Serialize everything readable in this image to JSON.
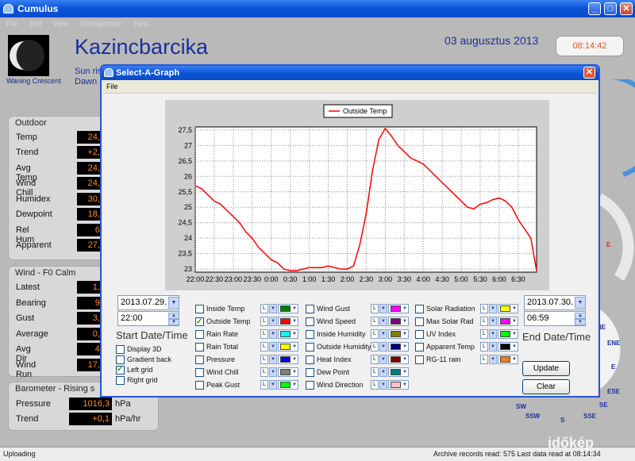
{
  "app": {
    "title": "Cumulus",
    "menu": [
      "File",
      "Edit",
      "View",
      "Configuration",
      "Help"
    ],
    "window_buttons": [
      "_",
      "□",
      "✕"
    ],
    "moon_phase": "Waning Crescent",
    "station": "Kazincbarcika",
    "date": "03 augusztus 2013",
    "time": "08:14:42",
    "sun_partial": "Sun ris",
    "dawn_partial": "Dawn"
  },
  "outdoor": {
    "title": "Outdoor",
    "rows": [
      {
        "label": "Temp",
        "value": "24,3"
      },
      {
        "label": "Trend",
        "value": "+2,6"
      },
      {
        "label": "Avg Temp",
        "value": "24,6"
      },
      {
        "label": "Wind Chill",
        "value": "24,3"
      },
      {
        "label": "Humidex",
        "value": "30,4"
      },
      {
        "label": "Dewpoint",
        "value": "18,3"
      },
      {
        "label": "Rel Hum",
        "value": "69"
      },
      {
        "label": "Apparent",
        "value": "27,0"
      }
    ]
  },
  "wind": {
    "title": "Wind - F0 Calm",
    "rows": [
      {
        "label": "Latest",
        "value": "1,1"
      },
      {
        "label": "Bearing",
        "value": "90"
      },
      {
        "label": "Gust",
        "value": "3,6"
      },
      {
        "label": "Average",
        "value": "0,9"
      },
      {
        "label": "Avg Dir",
        "value": "46"
      },
      {
        "label": "Wind Run",
        "value": "17,4"
      }
    ]
  },
  "barometer": {
    "title": "Barometer - Rising s",
    "rows": [
      {
        "label": "Pressure",
        "value": "1016,3",
        "unit": "hPa"
      },
      {
        "label": "Trend",
        "value": "+0,1",
        "unit": "hPa/hr"
      }
    ]
  },
  "compass": {
    "labels": [
      "NE",
      "ENE",
      "E",
      "ESE",
      "SE",
      "SSE",
      "S",
      "SSW",
      "SW"
    ],
    "e_marker": "E"
  },
  "status": {
    "left": "Uploading",
    "right": "Archive records read: 575  Last data read at 08:14:34",
    "watermark": "időkép"
  },
  "dialog": {
    "title": "Select-A-Graph",
    "close": "✕",
    "menu": "File",
    "start_date": "2013.07.29.",
    "start_time": "22:00",
    "start_label": "Start Date/Time",
    "end_date": "2013.07.30.",
    "end_time": "06:59",
    "end_label": "End Date/Time",
    "options": [
      {
        "label": "Display 3D",
        "checked": false
      },
      {
        "label": "Gradient back",
        "checked": false
      },
      {
        "label": "Left grid",
        "checked": true
      },
      {
        "label": "Right grid",
        "checked": false
      }
    ],
    "col1": [
      {
        "label": "Inside Temp",
        "checked": false,
        "color": "#008000"
      },
      {
        "label": "Outside Temp",
        "checked": true,
        "color": "#ff0000"
      },
      {
        "label": "Rain Rate",
        "checked": false,
        "color": "#00ffff"
      },
      {
        "label": "Rain Total",
        "checked": false,
        "color": "#ffff00"
      },
      {
        "label": "Pressure",
        "checked": false,
        "color": "#0000ff"
      },
      {
        "label": "Wind Chill",
        "checked": false,
        "color": "#808080"
      },
      {
        "label": "Peak Gust",
        "checked": false,
        "color": "#00ff00"
      }
    ],
    "col2": [
      {
        "label": "Wind Gust",
        "checked": false,
        "color": "#ff00ff"
      },
      {
        "label": "Wind Speed",
        "checked": false,
        "color": "#800080"
      },
      {
        "label": "Inside Humidity",
        "checked": false,
        "color": "#808000"
      },
      {
        "label": "Outside Humidity",
        "checked": false,
        "color": "#000080"
      },
      {
        "label": "Heat Index",
        "checked": false,
        "color": "#800000"
      },
      {
        "label": "Dew Point",
        "checked": false,
        "color": "#008080"
      },
      {
        "label": "Wind Direction",
        "checked": false,
        "color": "#ffc0cb"
      }
    ],
    "col3": [
      {
        "label": "Solar Radiation",
        "checked": false,
        "color": "#ffff00"
      },
      {
        "label": "Max Solar Rad",
        "checked": false,
        "color": "#ff00ff"
      },
      {
        "label": "UV Index",
        "checked": false,
        "color": "#00ff00"
      },
      {
        "label": "Apparent Temp",
        "checked": false,
        "color": "#000000"
      },
      {
        "label": "RG-11 rain",
        "checked": false,
        "color": "#ff8000"
      }
    ],
    "axis_letter": "L",
    "update_label": "Update",
    "clear_label": "Clear"
  },
  "chart_data": {
    "type": "line",
    "legend": [
      "Outside Temp"
    ],
    "legend_position": "top-center",
    "grid": true,
    "ylim": [
      22.9,
      27.6
    ],
    "yticks": [
      "27,5",
      "27",
      "26,5",
      "26",
      "25,5",
      "25",
      "24,5",
      "24",
      "23,5",
      "23"
    ],
    "xticks": [
      "22:00",
      "22:30",
      "23:00",
      "23:30",
      "0:00",
      "0:30",
      "1:00",
      "1:30",
      "2:00",
      "2:30",
      "3:00",
      "3:30",
      "4:00",
      "4:30",
      "5:00",
      "5:30",
      "6:00",
      "6:30"
    ],
    "series": [
      {
        "name": "Outside Temp",
        "color": "#ff0000",
        "x": [
          "22:00",
          "22:10",
          "22:20",
          "22:30",
          "22:40",
          "22:50",
          "23:00",
          "23:10",
          "23:20",
          "23:30",
          "23:40",
          "23:50",
          "0:00",
          "0:10",
          "0:20",
          "0:30",
          "0:40",
          "0:50",
          "1:00",
          "1:10",
          "1:20",
          "1:30",
          "1:40",
          "1:50",
          "2:00",
          "2:10",
          "2:20",
          "2:30",
          "2:40",
          "2:50",
          "3:00",
          "3:10",
          "3:20",
          "3:30",
          "3:40",
          "3:50",
          "4:00",
          "4:10",
          "4:20",
          "4:30",
          "4:40",
          "4:50",
          "5:00",
          "5:10",
          "5:20",
          "5:30",
          "5:40",
          "5:50",
          "6:00",
          "6:10",
          "6:20",
          "6:30",
          "6:40",
          "6:50",
          "6:59"
        ],
        "y": [
          25.7,
          25.6,
          25.4,
          25.2,
          25.1,
          24.9,
          24.7,
          24.5,
          24.2,
          24.0,
          23.7,
          23.5,
          23.3,
          23.2,
          23.0,
          22.95,
          22.95,
          23.0,
          23.05,
          23.05,
          23.05,
          23.1,
          23.05,
          23.0,
          23.0,
          23.1,
          23.8,
          24.8,
          26.2,
          27.2,
          27.55,
          27.3,
          27.0,
          26.8,
          26.6,
          26.5,
          26.4,
          26.2,
          26.0,
          25.8,
          25.6,
          25.4,
          25.2,
          25.0,
          24.95,
          25.1,
          25.15,
          25.25,
          25.3,
          25.2,
          25.0,
          24.6,
          24.3,
          24.0,
          22.95
        ]
      }
    ]
  }
}
